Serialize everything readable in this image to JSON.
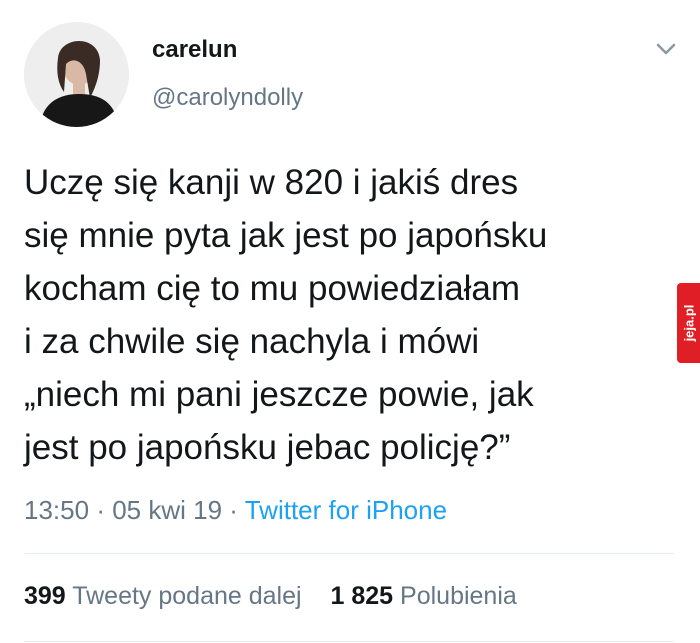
{
  "tweet": {
    "display_name": "carelun",
    "handle": "@carolyndolly",
    "lines": [
      "Uczę się kanji w 820 i jakiś dres",
      "się mnie pyta jak jest po japońsku",
      "kocham cię to mu powiedziałam",
      "i za chwile się nachyla i mówi",
      "„niech mi pani jeszcze powie, jak",
      "jest po japońsku jebac policję?”"
    ],
    "time": "13:50",
    "date": "05 kwi 19",
    "separator": "·",
    "source": "Twitter for iPhone"
  },
  "stats": {
    "retweets_count": "399",
    "retweets_label": "Tweety podane dalej",
    "likes_count": "1 825",
    "likes_label": "Polubienia"
  },
  "watermark": {
    "text": "jeja.pl",
    "color": "#e01e25"
  },
  "colors": {
    "text": "#14171a",
    "secondary": "#657786",
    "link": "#1da1f2",
    "divider": "#e6ecf0"
  },
  "icons": {
    "menu": "chevron-down-icon"
  }
}
